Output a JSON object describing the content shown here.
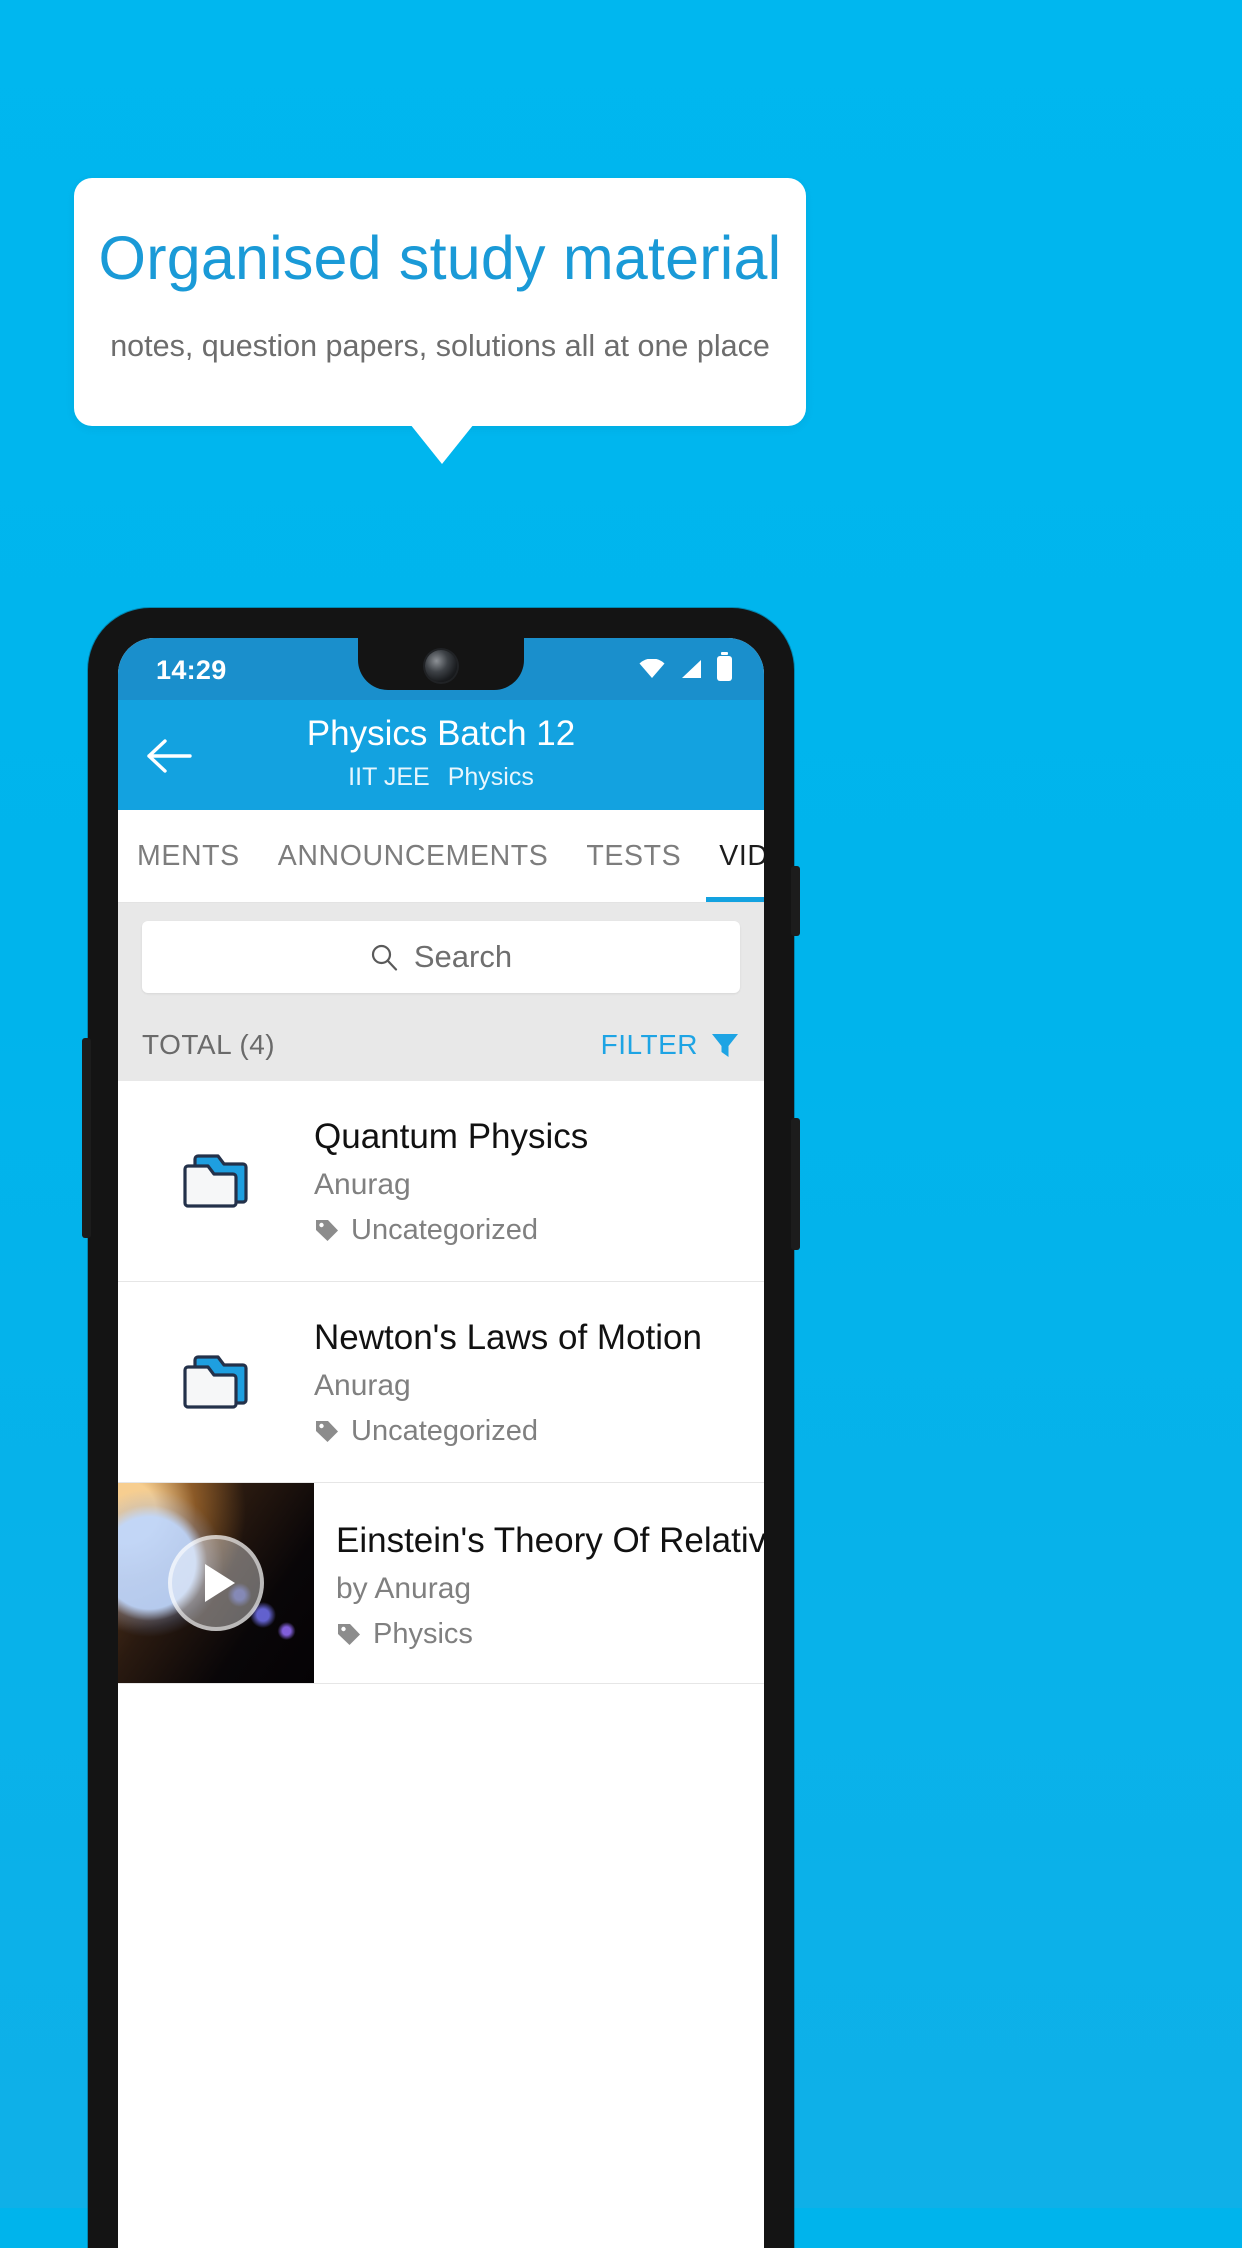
{
  "promo": {
    "title": "Organised study material",
    "subtitle": "notes, question papers, solutions all at one place",
    "title_color": "#1a9ad7",
    "subtitle_color": "#6d6d6d",
    "background_color": "#00b4ec"
  },
  "status_bar": {
    "time": "14:29",
    "icons": [
      "wifi-icon",
      "signal-icon",
      "battery-icon"
    ]
  },
  "app_bar": {
    "back_icon": "back-arrow-icon",
    "title": "Physics Batch 12",
    "exam": "IIT JEE",
    "subject": "Physics",
    "color": "#13a2e0"
  },
  "tabs": [
    {
      "label": "MENTS",
      "active": false
    },
    {
      "label": "ANNOUNCEMENTS",
      "active": false
    },
    {
      "label": "TESTS",
      "active": false
    },
    {
      "label": "VIDEOS",
      "active": true
    }
  ],
  "search": {
    "placeholder": "Search",
    "icon": "search-icon"
  },
  "toolbar": {
    "total_label": "TOTAL (4)",
    "filter_label": "FILTER",
    "filter_icon": "filter-icon",
    "filter_color": "#1ea4e4"
  },
  "list": [
    {
      "type": "folder",
      "icon": "folder-icon",
      "title": "Quantum Physics",
      "author": "Anurag",
      "tag": "Uncategorized",
      "tag_icon": "tag-icon"
    },
    {
      "type": "folder",
      "icon": "folder-icon",
      "title": "Newton's Laws of Motion",
      "author": "Anurag",
      "tag": "Uncategorized",
      "tag_icon": "tag-icon"
    },
    {
      "type": "video",
      "icon": "video-thumbnail",
      "play_icon": "play-icon",
      "title": "Einstein's Theory Of Relativity",
      "author": "by Anurag",
      "tag": "Physics",
      "tag_icon": "tag-icon"
    }
  ]
}
